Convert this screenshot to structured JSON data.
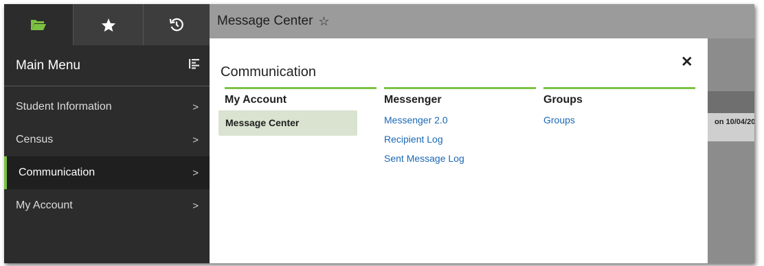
{
  "sidebar": {
    "tabs": [
      {
        "icon": "folder-open-icon",
        "color": "#7cc242"
      },
      {
        "icon": "star-icon",
        "color": "#ffffff"
      },
      {
        "icon": "history-icon",
        "color": "#ffffff"
      }
    ],
    "title": "Main Menu",
    "title_icon": "list-tree-icon",
    "items": [
      {
        "label": "Student Information",
        "active": false
      },
      {
        "label": "Census",
        "active": false
      },
      {
        "label": "Communication",
        "active": true
      },
      {
        "label": "My Account",
        "active": false
      }
    ]
  },
  "header": {
    "title": "Message Center",
    "favorite_icon": "star-outline-icon"
  },
  "background_fragment": {
    "text": "on 10/04/20"
  },
  "flyout": {
    "title": "Communication",
    "columns": [
      {
        "heading": "My Account",
        "links": [
          "Message Center"
        ],
        "selected": "Message Center"
      },
      {
        "heading": "Messenger",
        "links": [
          "Messenger 2.0",
          "Recipient Log",
          "Sent Message Log"
        ]
      },
      {
        "heading": "Groups",
        "links": [
          "Groups"
        ]
      }
    ]
  },
  "colors": {
    "accent": "#7cc242",
    "link": "#1a67b5",
    "sidebar_bg": "#2c2c2c",
    "selected_bg": "#d9e3d0"
  }
}
